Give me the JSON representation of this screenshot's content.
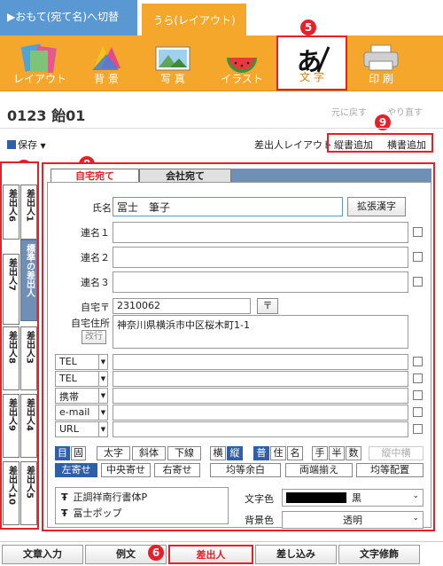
{
  "top_tabs": {
    "front": "▶おもて(宛て名)へ切替",
    "back": "うら(レイアウト)"
  },
  "toolbar": {
    "items": [
      {
        "label": "レイアウト",
        "icon": "layout-icon"
      },
      {
        "label": "背 景",
        "icon": "background-icon"
      },
      {
        "label": "写 真",
        "icon": "photo-icon"
      },
      {
        "label": "イラスト",
        "icon": "illustration-icon"
      },
      {
        "label": "文 字",
        "icon": "text-icon"
      },
      {
        "label": "印 刷",
        "icon": "printer-icon"
      }
    ]
  },
  "callouts": {
    "c5": "5",
    "c6": "6",
    "c7": "7",
    "c8": "8",
    "c9": "9"
  },
  "header": {
    "title": "0123 飴01",
    "undo": "元に戻す",
    "redo": "やり直す",
    "save": "保存",
    "sender_layout": "差出人レイアウト",
    "add_vertical": "縦書追加",
    "add_horizontal": "横書追加"
  },
  "left_tabs": [
    {
      "label": "差出人6"
    },
    {
      "label": "差出人1"
    },
    {
      "label": "標準の差出人"
    },
    {
      "label": "差出人7"
    },
    {
      "label": "差出人8"
    },
    {
      "label": "差出人3"
    },
    {
      "label": "差出人9"
    },
    {
      "label": "差出人4"
    },
    {
      "label": "差出人10"
    },
    {
      "label": "差出人5"
    }
  ],
  "panel": {
    "tab_home": "自宅宛て",
    "tab_company": "会社宛て",
    "name_label": "氏名",
    "name_value": "冨士　筆子",
    "expand_kanji": "拡張漢字",
    "joint1": "連名１",
    "joint2": "連名２",
    "joint3": "連名３",
    "zip_label": "自宅〒",
    "zip_value": "2310062",
    "zip_btn": "〒",
    "addr_label": "自宅住所",
    "newline": "改行",
    "addr_value": "神奈川県横浜市中区桜木町1-1",
    "contacts": [
      "TEL",
      "TEL",
      "携帯",
      "e-mail",
      "URL"
    ]
  },
  "style_row1": [
    "目",
    "固",
    "太字",
    "斜体",
    "下線",
    "横",
    "縦",
    "普",
    "住",
    "名",
    "手",
    "半",
    "数",
    "縦中横"
  ],
  "style_row2": [
    "左寄せ",
    "中央寄せ",
    "右寄せ",
    "均等余白",
    "両端揃え",
    "均等配置"
  ],
  "fonts": [
    "正調祥南行書体P",
    "冨士ポップ"
  ],
  "colors": {
    "text_label": "文字色",
    "text_value": "黒",
    "bg_label": "背景色",
    "bg_value": "透明",
    "accent": "#f5a72c",
    "red": "#e81e28",
    "blue": "#2f5fa8"
  },
  "bottom": [
    "文章入力",
    "例文",
    "差出人",
    "差し込み",
    "文字修飾"
  ]
}
